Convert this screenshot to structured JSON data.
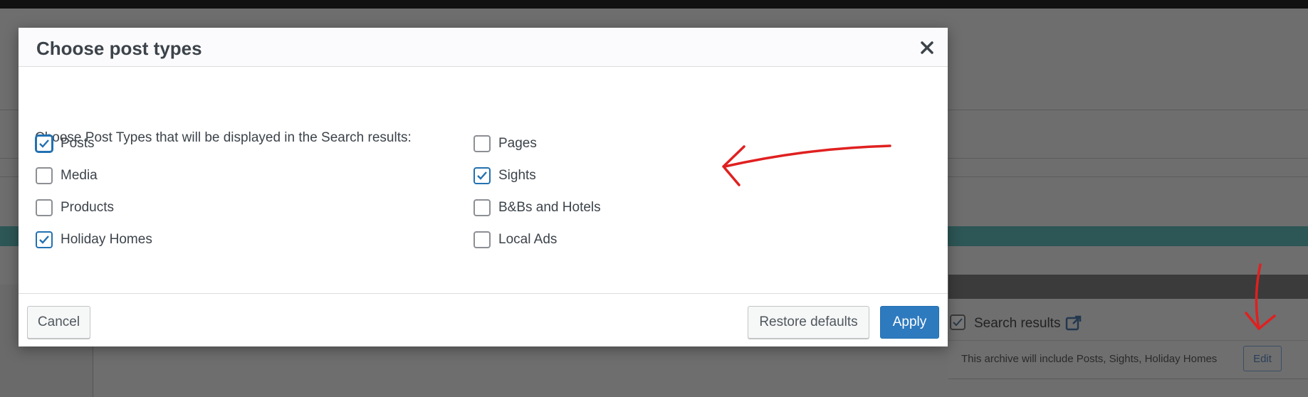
{
  "modal": {
    "title": "Choose post types",
    "intro": "Choose Post Types that will be displayed in the Search results:",
    "options_left": [
      {
        "label": "Posts",
        "checked": true
      },
      {
        "label": "Media",
        "checked": false
      },
      {
        "label": "Products",
        "checked": false
      },
      {
        "label": "Holiday Homes",
        "checked": true
      }
    ],
    "options_right": [
      {
        "label": "Pages",
        "checked": false
      },
      {
        "label": "Sights",
        "checked": true
      },
      {
        "label": "B&Bs and Hotels",
        "checked": false
      },
      {
        "label": "Local Ads",
        "checked": false
      }
    ],
    "footer": {
      "cancel_label": "Cancel",
      "restore_label": "Restore defaults",
      "apply_label": "Apply"
    }
  },
  "background_panel": {
    "title": "Search results",
    "description": "This archive will include Posts, Sights, Holiday Homes",
    "edit_label": "Edit"
  },
  "colors": {
    "accent": "#2271b1",
    "annotation": "#e02020"
  }
}
